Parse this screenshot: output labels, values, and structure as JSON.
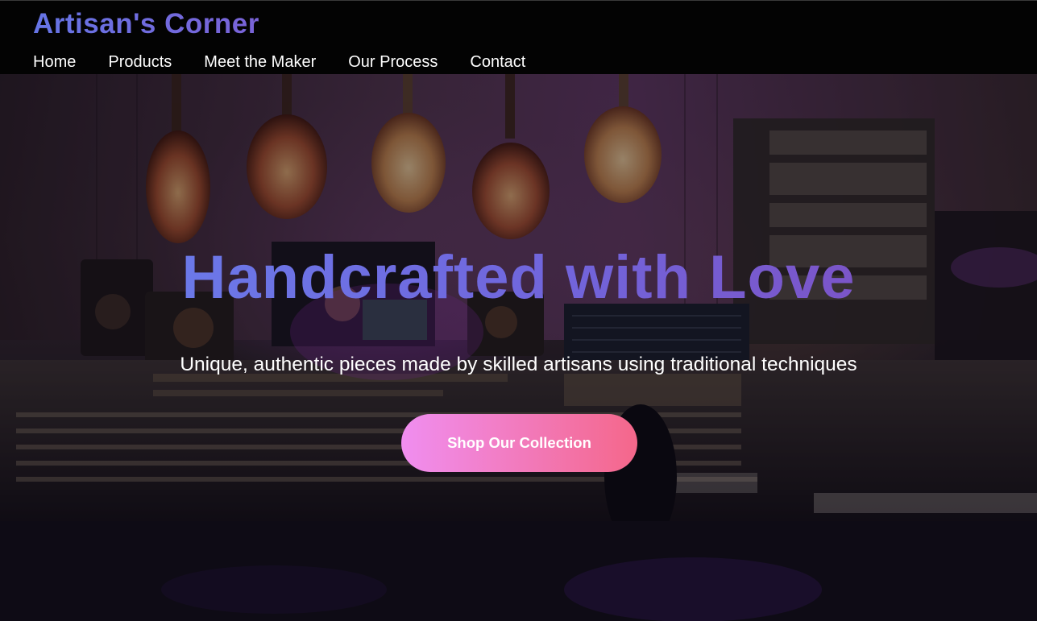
{
  "header": {
    "brand": "Artisan's Corner",
    "nav": [
      {
        "label": "Home"
      },
      {
        "label": "Products"
      },
      {
        "label": "Meet the Maker"
      },
      {
        "label": "Our Process"
      },
      {
        "label": "Contact"
      }
    ]
  },
  "hero": {
    "title": "Handcrafted with Love",
    "subtitle": "Unique, authentic pieces made by skilled artisans using traditional techniques",
    "cta_label": "Shop Our Collection",
    "background_description_icon": "music-studio-photo"
  },
  "colors": {
    "accent_start": "#6675e6",
    "accent_end": "#7a63d8",
    "cta_start": "#f08ef0",
    "cta_end": "#f4678a",
    "header_bg": "#030303"
  }
}
